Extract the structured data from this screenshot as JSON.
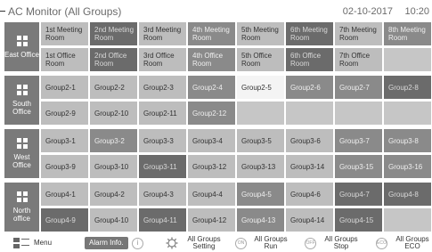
{
  "header": {
    "title": "AC Monitor (All Groups)",
    "date": "02-10-2017",
    "time": "10:20"
  },
  "offices": [
    {
      "name": "East Office",
      "color": "#7a7a7a",
      "rows": [
        [
          {
            "label": "1st Meeting Room",
            "state": "l"
          },
          {
            "label": "2nd Meeting Room",
            "state": "d"
          },
          {
            "label": "3rd Meeting Room",
            "state": "l"
          },
          {
            "label": "4th Meeting Room",
            "state": "wd"
          },
          {
            "label": "5th Meeting Room",
            "state": "l"
          },
          {
            "label": "6th Meeting Room",
            "state": "d"
          },
          {
            "label": "7th Meeting Room",
            "state": "l"
          },
          {
            "label": "8th Meeting Room",
            "state": "wd"
          }
        ],
        [
          {
            "label": "1st Office Room",
            "state": "l"
          },
          {
            "label": "2nd Office Room",
            "state": "d"
          },
          {
            "label": "3rd Office Room",
            "state": "l"
          },
          {
            "label": "4th Office Room",
            "state": "wd"
          },
          {
            "label": "5th Office Room",
            "state": "l"
          },
          {
            "label": "6th Office Room",
            "state": "d"
          },
          {
            "label": "7th Office Room",
            "state": "l"
          },
          {
            "label": "",
            "state": "e"
          }
        ]
      ]
    },
    {
      "name": "South Office",
      "color": "#7a7a7a",
      "rows": [
        [
          {
            "label": "Group2-1",
            "state": "l"
          },
          {
            "label": "Group2-2",
            "state": "l"
          },
          {
            "label": "Group2-3",
            "state": "l"
          },
          {
            "label": "Group2-4",
            "state": "wd"
          },
          {
            "label": "Group2-5",
            "state": "w"
          },
          {
            "label": "Group2-6",
            "state": "wd"
          },
          {
            "label": "Group2-7",
            "state": "wd"
          },
          {
            "label": "Group2-8",
            "state": "d"
          }
        ],
        [
          {
            "label": "Group2-9",
            "state": "l"
          },
          {
            "label": "Group2-10",
            "state": "l"
          },
          {
            "label": "Group2-11",
            "state": "l"
          },
          {
            "label": "Group2-12",
            "state": "wd"
          },
          {
            "label": "",
            "state": "e"
          },
          {
            "label": "",
            "state": "e"
          },
          {
            "label": "",
            "state": "e"
          },
          {
            "label": "",
            "state": "e"
          }
        ]
      ]
    },
    {
      "name": "West Office",
      "color": "#7a7a7a",
      "rows": [
        [
          {
            "label": "Group3-1",
            "state": "l"
          },
          {
            "label": "Group3-2",
            "state": "wd"
          },
          {
            "label": "Group3-3",
            "state": "l"
          },
          {
            "label": "Group3-4",
            "state": "l"
          },
          {
            "label": "Group3-5",
            "state": "l"
          },
          {
            "label": "Group3-6",
            "state": "l"
          },
          {
            "label": "Group3-7",
            "state": "wd"
          },
          {
            "label": "Group3-8",
            "state": "wd"
          }
        ],
        [
          {
            "label": "Group3-9",
            "state": "l"
          },
          {
            "label": "Group3-10",
            "state": "l"
          },
          {
            "label": "Group3-11",
            "state": "d"
          },
          {
            "label": "Group3-12",
            "state": "l"
          },
          {
            "label": "Group3-13",
            "state": "l"
          },
          {
            "label": "Group3-14",
            "state": "l"
          },
          {
            "label": "Group3-15",
            "state": "wd"
          },
          {
            "label": "Group3-16",
            "state": "wd"
          }
        ]
      ]
    },
    {
      "name": "North office",
      "color": "#7a7a7a",
      "rows": [
        [
          {
            "label": "Group4-1",
            "state": "l"
          },
          {
            "label": "Group4-2",
            "state": "l"
          },
          {
            "label": "Group4-3",
            "state": "l"
          },
          {
            "label": "Group4-4",
            "state": "l"
          },
          {
            "label": "Group4-5",
            "state": "wd"
          },
          {
            "label": "Group4-6",
            "state": "l"
          },
          {
            "label": "Group4-7",
            "state": "d"
          },
          {
            "label": "Group4-8",
            "state": "d"
          }
        ],
        [
          {
            "label": "Group4-9",
            "state": "d"
          },
          {
            "label": "Group4-10",
            "state": "l"
          },
          {
            "label": "Group4-11",
            "state": "d"
          },
          {
            "label": "Group4-12",
            "state": "l"
          },
          {
            "label": "Group4-13",
            "state": "wd"
          },
          {
            "label": "Group4-14",
            "state": "l"
          },
          {
            "label": "Group4-15",
            "state": "d"
          },
          {
            "label": "",
            "state": "e"
          }
        ]
      ]
    }
  ],
  "footer": {
    "menu_label": "Menu",
    "alarm_label": "Alarm Info.",
    "info_glyph": "i",
    "setting_label": "All Groups Setting",
    "run_label": "All Groups Run",
    "run_icon_text": "ON",
    "stop_label": "All Groups Stop",
    "stop_icon_text": "OFF",
    "eco_label": "All Groups ECO",
    "eco_icon_text": "ECO"
  }
}
